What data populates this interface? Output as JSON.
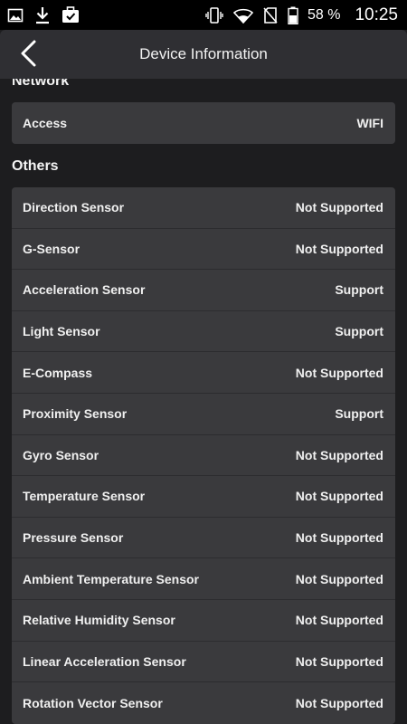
{
  "status_bar": {
    "icons_left": [
      "image-icon",
      "download-icon",
      "briefcase-check-icon"
    ],
    "icons_right": [
      "vibrate-icon",
      "wifi-icon",
      "no-sim-icon",
      "battery-icon"
    ],
    "battery": "58 %",
    "time": "10:25"
  },
  "app_bar": {
    "title": "Device Information",
    "back_icon": "chevron-left-icon"
  },
  "sections": {
    "network": {
      "header": "Network",
      "rows": [
        {
          "label": "Access",
          "value": "WIFI"
        }
      ]
    },
    "others": {
      "header": "Others",
      "rows": [
        {
          "label": "Direction Sensor",
          "value": "Not Supported"
        },
        {
          "label": "G-Sensor",
          "value": "Not Supported"
        },
        {
          "label": "Acceleration Sensor",
          "value": "Support"
        },
        {
          "label": "Light Sensor",
          "value": "Support"
        },
        {
          "label": "E-Compass",
          "value": "Not Supported"
        },
        {
          "label": "Proximity Sensor",
          "value": "Support"
        },
        {
          "label": "Gyro Sensor",
          "value": "Not Supported"
        },
        {
          "label": "Temperature Sensor",
          "value": "Not Supported"
        },
        {
          "label": "Pressure Sensor",
          "value": "Not Supported"
        },
        {
          "label": "Ambient Temperature Sensor",
          "value": "Not Supported"
        },
        {
          "label": "Relative Humidity Sensor",
          "value": "Not Supported"
        },
        {
          "label": "Linear Acceleration Sensor",
          "value": "Not Supported"
        },
        {
          "label": "Rotation Vector Sensor",
          "value": "Not Supported"
        }
      ]
    }
  },
  "colors": {
    "background": "#1d1d1f",
    "app_bar": "#2f2f33",
    "card": "#3a3a3d",
    "text": "#f0f0f0"
  }
}
